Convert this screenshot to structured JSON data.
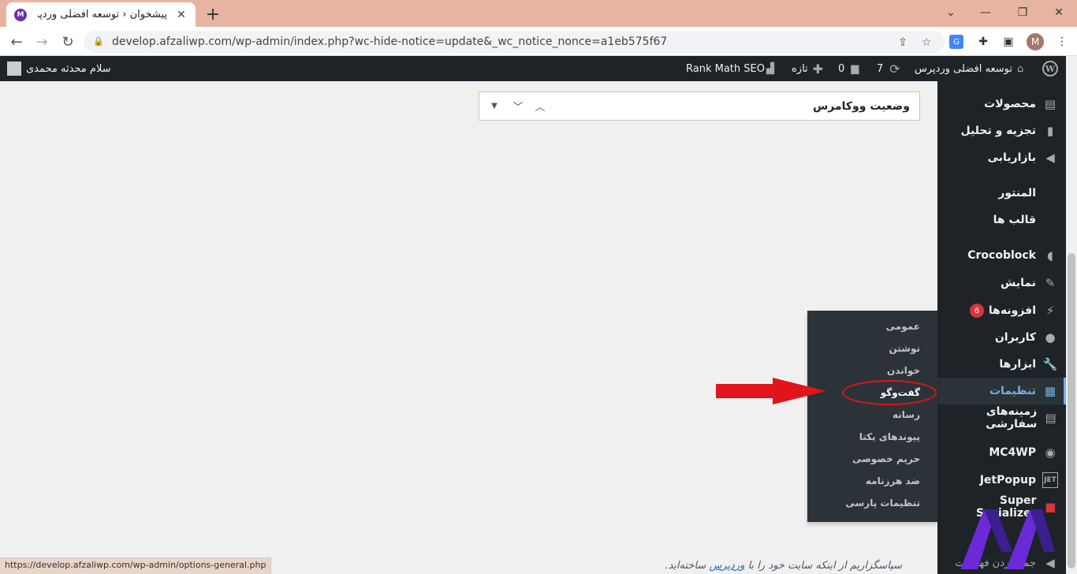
{
  "browser": {
    "tab_title": "پیشخوان ‹ توسعه افضلی وردپرس -",
    "tab_favicon": "M",
    "url": "develop.afzaliwp.com/wp-admin/index.php?wc-hide-notice=update&_wc_notice_nonce=a1eb575f67",
    "profile_initial": "M",
    "status_url": "https://develop.afzaliwp.com/wp-admin/options-general.php"
  },
  "adminbar": {
    "site_name": "توسعه افضلی وردپرس",
    "updates_count": "7",
    "comments_count": "0",
    "new_label": "تازه",
    "rank_math": "Rank Math SEO",
    "greeting": "سلام محدثه محمدی"
  },
  "sidebar": {
    "items": [
      {
        "label": "محصولات",
        "icon": "archive-icon"
      },
      {
        "label": "تجزیه و تحلیل",
        "icon": "chart-bar-icon"
      },
      {
        "label": "بازاریابی",
        "icon": "megaphone-icon"
      },
      {
        "label": "المنتور",
        "icon": ""
      },
      {
        "label": "قالب ها",
        "icon": ""
      },
      {
        "label": "Crocoblock",
        "icon": "crocoblock-icon"
      },
      {
        "label": "نمایش",
        "icon": "brush-icon"
      },
      {
        "label": "افزونه‌ها",
        "icon": "plugin-icon",
        "badge": "6"
      },
      {
        "label": "کاربران",
        "icon": "user-icon"
      },
      {
        "label": "ابزارها",
        "icon": "wrench-icon"
      },
      {
        "label": "تنظیمات",
        "icon": "settings-icon",
        "active": true
      },
      {
        "label": "زمینه‌های سفارشی",
        "icon": "table-icon"
      },
      {
        "label": "MC4WP",
        "icon": "mc4wp-icon"
      },
      {
        "label": "JetPopup",
        "icon": "jet-icon"
      },
      {
        "label": "Super Socializer",
        "icon": "socializer-icon"
      },
      {
        "label": "جمع کردن فهرست",
        "icon": "collapse-icon"
      }
    ]
  },
  "flyout": {
    "items": [
      "عمومی",
      "نوشتن",
      "خواندن",
      "گفت‌وگو",
      "رسانه",
      "پیوندهای یکتا",
      "حریم خصوصی",
      "ضد هرزنامه",
      "تنظیمات پارسی"
    ]
  },
  "postbox": {
    "title": "وضعیت ووکامرس"
  },
  "footer": {
    "before": "سپاسگزاریم از اینکه سایت خود را با ",
    "link": "وردپرس",
    "after": " ساخته‌اید."
  },
  "colors": {
    "adminbar": "#1d2327",
    "accent": "#72aee6",
    "arrow": "#e0141b",
    "tabbar": "#e8b4a2"
  }
}
